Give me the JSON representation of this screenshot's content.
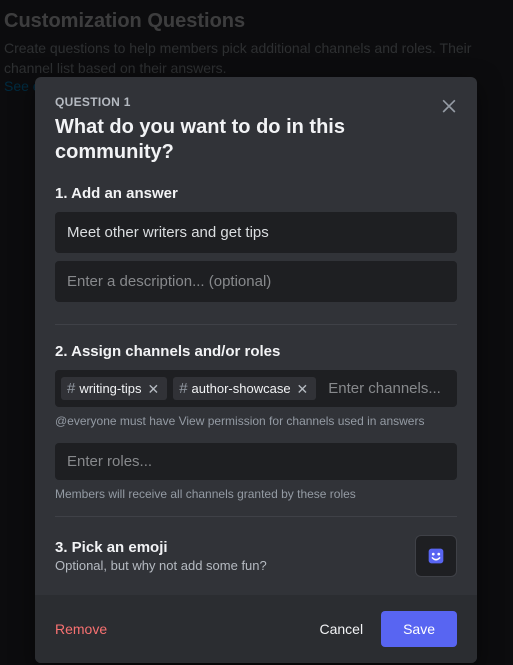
{
  "background": {
    "title": "Customization Questions",
    "subtitle": "Create questions to help members pick additional channels and roles. Their channel list based on their answers.",
    "link": "See e"
  },
  "modal": {
    "question_label": "QUESTION 1",
    "question_title": "What do you want to do in this community?",
    "section1": {
      "head": "1. Add an answer",
      "answer_value": "Meet other writers and get tips",
      "description_placeholder": "Enter a description... (optional)"
    },
    "section2": {
      "head": "2. Assign channels and/or roles",
      "channels": [
        "writing-tips",
        "author-showcase"
      ],
      "channels_placeholder": "Enter channels...",
      "channels_helper": "@everyone must have View permission for channels used in answers",
      "roles_placeholder": "Enter roles...",
      "roles_helper": "Members will receive all channels granted by these roles"
    },
    "section3": {
      "head": "3. Pick an emoji",
      "sub": "Optional, but why not add some fun?"
    },
    "footer": {
      "remove": "Remove",
      "cancel": "Cancel",
      "save": "Save"
    }
  }
}
